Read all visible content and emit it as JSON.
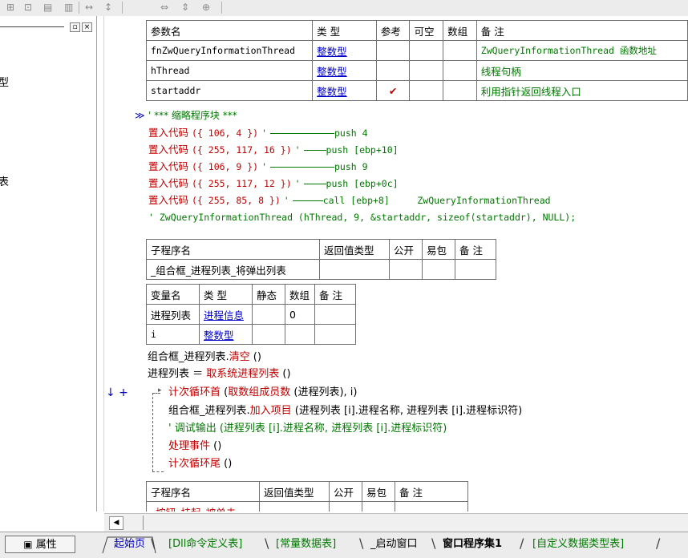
{
  "toolbar": {
    "icons": [
      "grid-icon",
      "layout-icon",
      "tile-icon",
      "split-icon",
      "width-icon",
      "height-icon",
      "hspace-icon",
      "vspace-icon",
      "center-icon"
    ]
  },
  "left_panel": {
    "close_glyph": "×",
    "restore_glyph": "▫",
    "items": [
      "型",
      "表"
    ]
  },
  "params_table": {
    "headers": [
      "参数名",
      "类 型",
      "参考",
      "可空",
      "数组",
      "备 注"
    ],
    "rows": [
      {
        "name": "fnZwQueryInformationThread",
        "type": "整数型",
        "ref": "",
        "note": "ZwQueryInformationThread 函数地址"
      },
      {
        "name": "hThread",
        "type": "整数型",
        "ref": "",
        "note": "线程句柄"
      },
      {
        "name": "startaddr",
        "type": "整数型",
        "ref": "✔",
        "note": "利用指针返回线程入口"
      }
    ]
  },
  "code": {
    "marker": "≫",
    "comment_line": "' *** 缩略程序块 ***",
    "lines": [
      {
        "fn": "置入代码",
        "args": "({ 106, 4 })",
        "q": "'",
        "asm": "push 4"
      },
      {
        "fn": "置入代码",
        "args": "({ 255, 117, 16 })",
        "q": "'",
        "asm": "push [ebp+10]"
      },
      {
        "fn": "置入代码",
        "args": "({ 106, 9 })",
        "q": "'",
        "asm": "push 9"
      },
      {
        "fn": "置入代码",
        "args": "({ 255, 117, 12 })",
        "q": "'",
        "asm": "push [ebp+0c]"
      },
      {
        "fn": "置入代码",
        "args": "({ 255, 85, 8 })",
        "q": "'",
        "asm": "call [ebp+8]     ZwQueryInformationThread"
      }
    ],
    "tail_comment": "' ZwQueryInformationThread (hThread, 9, &startaddr, sizeof(startaddr), NULL);"
  },
  "sub1_table": {
    "headers": [
      "子程序名",
      "返回值类型",
      "公开",
      "易包",
      "备 注"
    ],
    "name": "_组合框_进程列表_将弹出列表"
  },
  "var_table": {
    "headers": [
      "变量名",
      "类 型",
      "静态",
      "数组",
      "备 注"
    ],
    "rows": [
      {
        "name": "进程列表",
        "type": "进程信息",
        "array": "0"
      },
      {
        "name": "i",
        "type": "整数型",
        "array": ""
      }
    ]
  },
  "body": {
    "l1_obj": "组合框_进程列表.",
    "l1_fn": "清空",
    "l1_args": " ()",
    "l2_a": "进程列表 ＝ ",
    "l2_fn": "取系统进程列表",
    "l2_args": " ()",
    "markers": "↓ +",
    "l3_fn": "计次循环首",
    "l3_p": " (",
    "l3_fn2": "取数组成员数",
    "l3_rest": " (进程列表), i)",
    "l4_obj": "组合框_进程列表.",
    "l4_fn": "加入项目",
    "l4_rest": " (进程列表 [i].进程名称, 进程列表 [i].进程标识符)",
    "l5": "' 调试输出 (进程列表 [i].进程名称, 进程列表 [i].进程标识符)",
    "l6_fn": "处理事件",
    "l6_rest": " ()",
    "l7_fn": "计次循环尾",
    "l7_rest": " ()"
  },
  "sub2_table": {
    "headers": [
      "子程序名",
      "返回值类型",
      "公开",
      "易包",
      "备 注"
    ],
    "name": "_按钮_挂起_被单击"
  },
  "scroll": {
    "left_glyph": "◀"
  },
  "tabs": {
    "property_button": "属性",
    "items": [
      "起始页",
      "[Dll命令定义表]",
      "[常量数据表]",
      "_启动窗口",
      "窗口程序集1",
      "[自定义数据类型表]"
    ],
    "active": "窗口程序集1"
  },
  "colors": {
    "keyword": "#c00000",
    "type": "#0000c8",
    "comment": "#007800"
  }
}
